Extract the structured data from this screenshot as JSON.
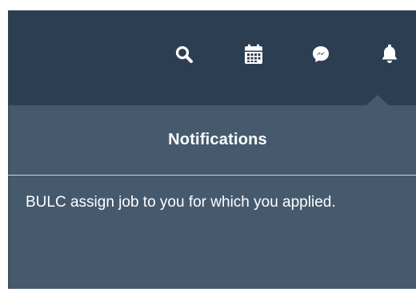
{
  "header": {
    "icons": {
      "search": "search-icon",
      "calendar": "calendar-icon",
      "chat": "chat-icon",
      "bell": "bell-icon"
    }
  },
  "notifications": {
    "title": "Notifications",
    "items": [
      {
        "text": "BULC assign job to you for which you applied."
      }
    ]
  },
  "colors": {
    "topbar_bg": "#2c3e52",
    "panel_bg": "#465a6e",
    "divider": "#c9d2dc",
    "text": "#ffffff"
  }
}
